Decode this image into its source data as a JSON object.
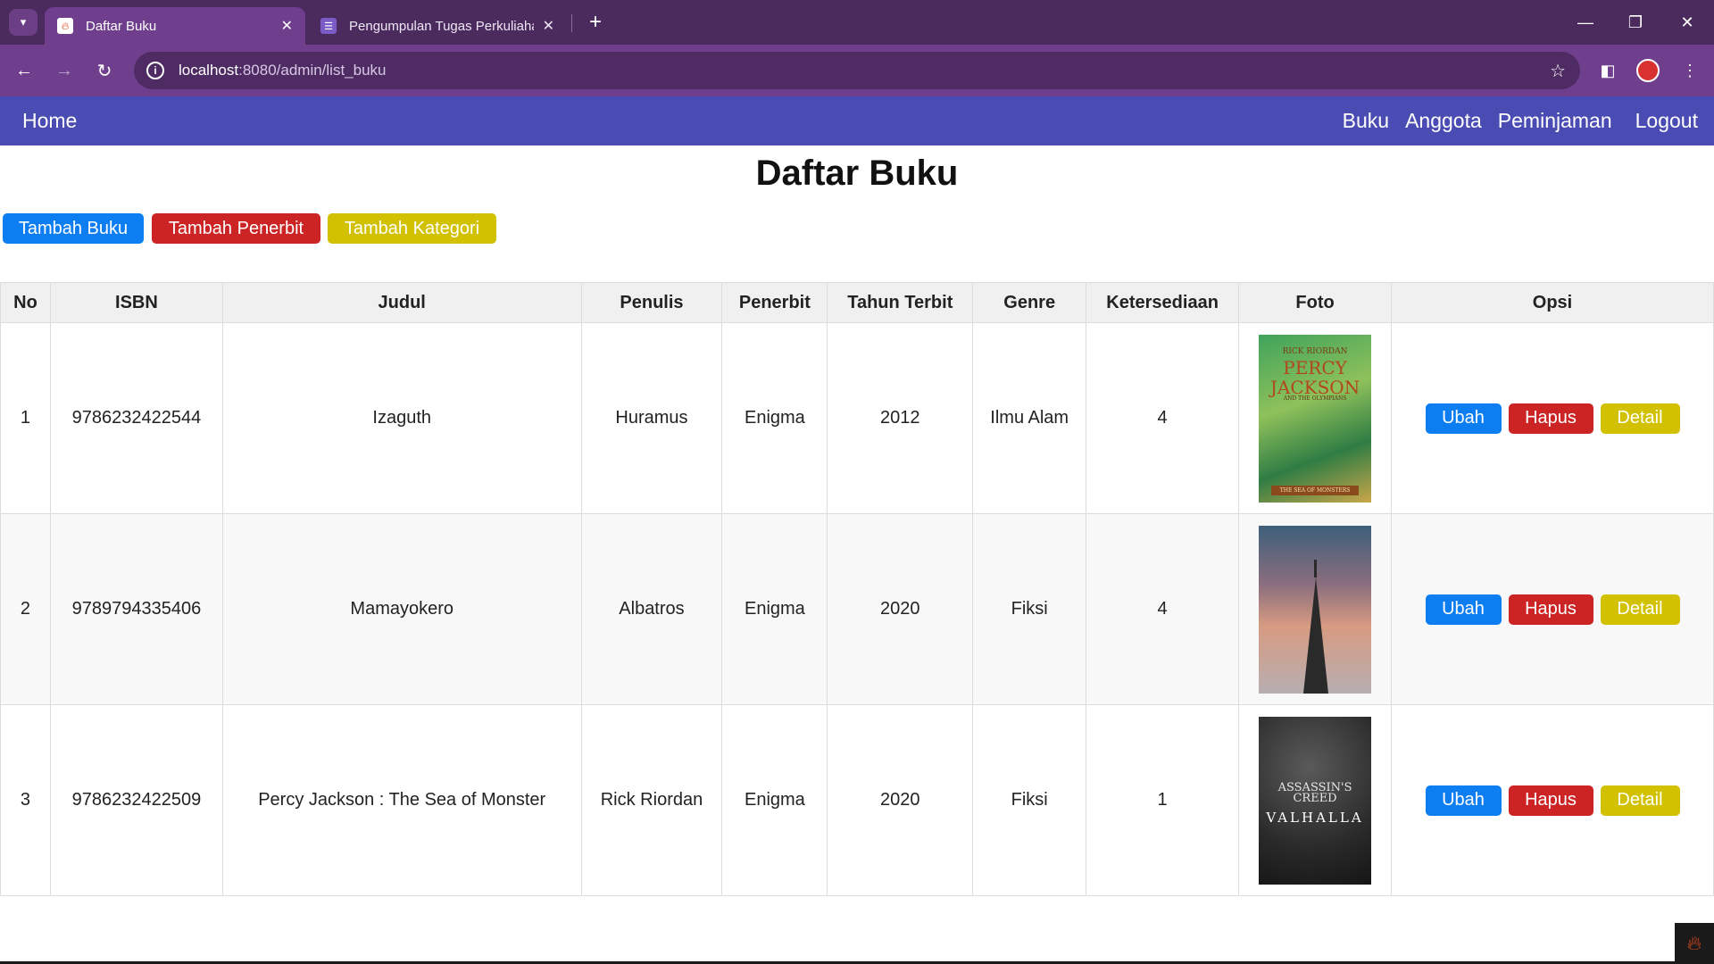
{
  "browser": {
    "tabs": [
      {
        "label": "Daftar Buku",
        "active": true
      },
      {
        "label": "Pengumpulan Tugas Perkuliahan",
        "active": false
      }
    ],
    "url_host": "localhost",
    "url_path": ":8080/admin/list_buku",
    "theme_color": "#6f3f8e"
  },
  "navbar": {
    "home": "Home",
    "links": [
      "Buku",
      "Anggota",
      "Peminjaman"
    ],
    "logout": "Logout",
    "color": "#4a4cb4"
  },
  "page": {
    "title": "Daftar Buku",
    "buttons": {
      "add_book": "Tambah Buku",
      "add_publisher": "Tambah Penerbit",
      "add_category": "Tambah Kategori"
    }
  },
  "table": {
    "headers": [
      "No",
      "ISBN",
      "Judul",
      "Penulis",
      "Penerbit",
      "Tahun Terbit",
      "Genre",
      "Ketersediaan",
      "Foto",
      "Opsi"
    ],
    "rows": [
      {
        "no": "1",
        "isbn": "9786232422544",
        "judul": "Izaguth",
        "penulis": "Huramus",
        "penerbit": "Enigma",
        "tahun": "2012",
        "genre": "Ilmu Alam",
        "ketersediaan": "4",
        "foto": "percy-jackson-cover"
      },
      {
        "no": "2",
        "isbn": "9789794335406",
        "judul": "Mamayokero",
        "penulis": "Albatros",
        "penerbit": "Enigma",
        "tahun": "2020",
        "genre": "Fiksi",
        "ketersediaan": "4",
        "foto": "tower-sunset-cover"
      },
      {
        "no": "3",
        "isbn": "9786232422509",
        "judul": "Percy Jackson : The Sea of Monster",
        "penulis": "Rick Riordan",
        "penerbit": "Enigma",
        "tahun": "2020",
        "genre": "Fiksi",
        "ketersediaan": "1",
        "foto": "valhalla-cover"
      }
    ],
    "actions": {
      "edit": "Ubah",
      "delete": "Hapus",
      "detail": "Detail"
    }
  },
  "covers": {
    "percy": {
      "author": "RICK RIORDAN",
      "title": "PERCY JACKSON",
      "subtitle": "AND THE OLYMPIANS",
      "banner": "THE SEA OF MONSTERS"
    },
    "valhalla": {
      "line1": "ASSASSIN'S CREED",
      "line2": "VALHALLA"
    }
  },
  "colors": {
    "blue": "#0d7ef2",
    "red": "#cc2424",
    "yellow": "#d1c100"
  }
}
